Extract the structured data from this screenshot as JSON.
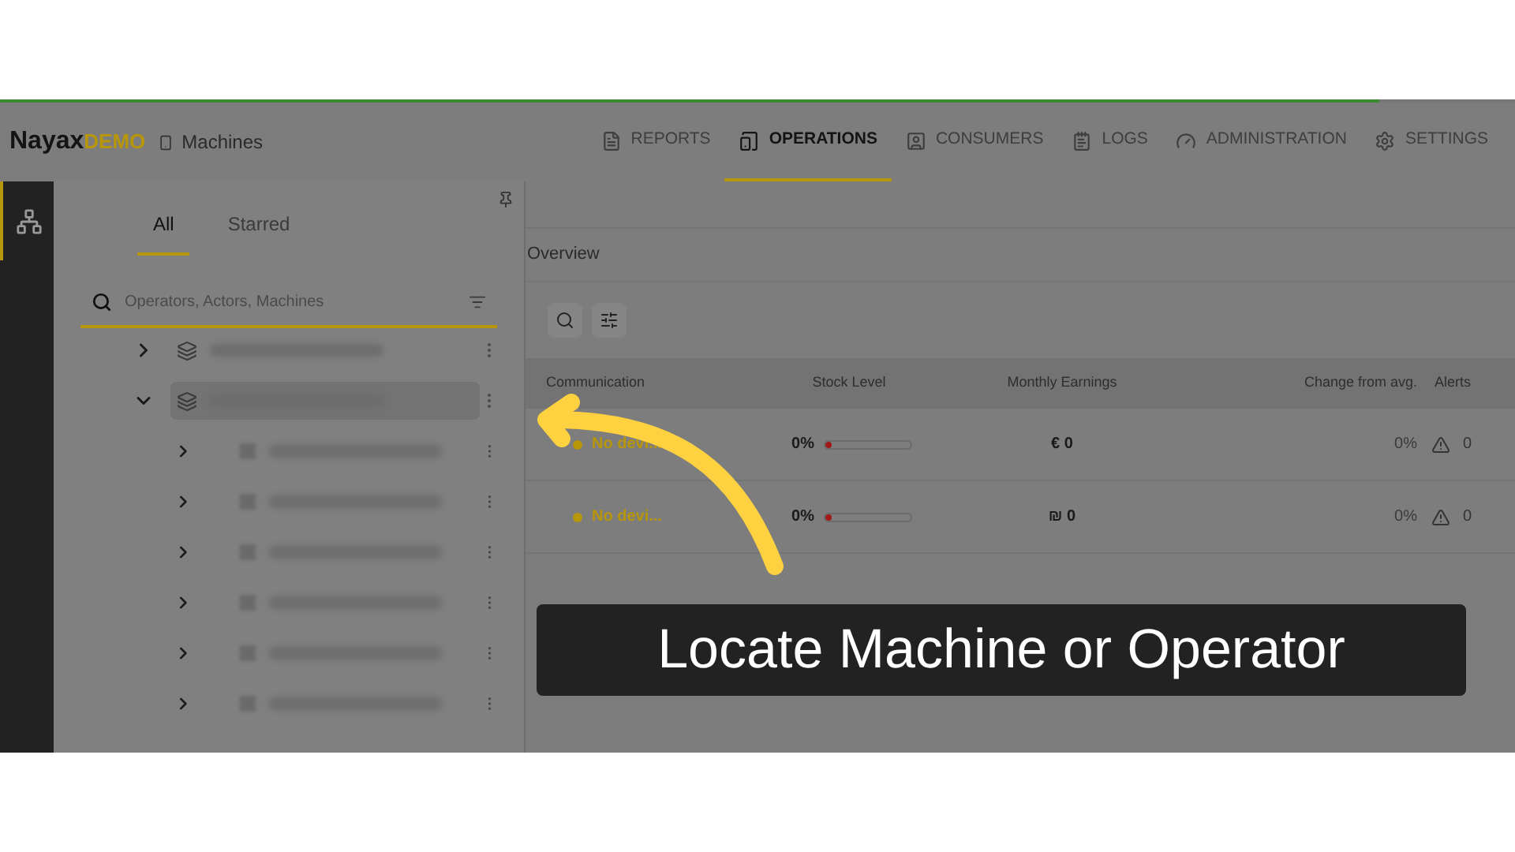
{
  "progress": {
    "level": 0.91
  },
  "header": {
    "logo": "Nayax",
    "logo_suffix": "DEMO",
    "breadcrumb": "Machines"
  },
  "nav": [
    {
      "label": "REPORTS",
      "selected": false
    },
    {
      "label": "OPERATIONS",
      "selected": true
    },
    {
      "label": "CONSUMERS",
      "selected": false
    },
    {
      "label": "LOGS",
      "selected": false
    },
    {
      "label": "ADMINISTRATION",
      "selected": false
    },
    {
      "label": "SETTINGS",
      "selected": false
    }
  ],
  "tree_tabs": [
    {
      "label": "All",
      "selected": true
    },
    {
      "label": "Starred",
      "selected": false
    }
  ],
  "tree_search": {
    "placeholder": "Operators, Actors, Machines"
  },
  "tree": [
    {
      "expanded": false
    },
    {
      "expanded": true,
      "children": [
        {
          "expanded": false
        },
        {
          "expanded": false
        },
        {
          "expanded": false
        },
        {
          "expanded": false
        },
        {
          "expanded": false
        },
        {
          "expanded": false
        }
      ]
    }
  ],
  "page_title": "Overview",
  "table": {
    "columns": [
      "Communication",
      "Stock Level",
      "Monthly Earnings",
      "Change from avg.",
      "Alerts"
    ],
    "rows": [
      {
        "status": "No devi...",
        "color": "#b8960a",
        "stock": "0%",
        "level": 0.0,
        "earnings": "€ 0",
        "change": "0%",
        "alerts": "0"
      },
      {
        "status": "No devi...",
        "color": "#b8960a",
        "stock": "0%",
        "level": 0.0,
        "earnings": "₪ 0",
        "change": "0%",
        "alerts": "0"
      }
    ]
  },
  "caption": "Locate Machine or Operator"
}
